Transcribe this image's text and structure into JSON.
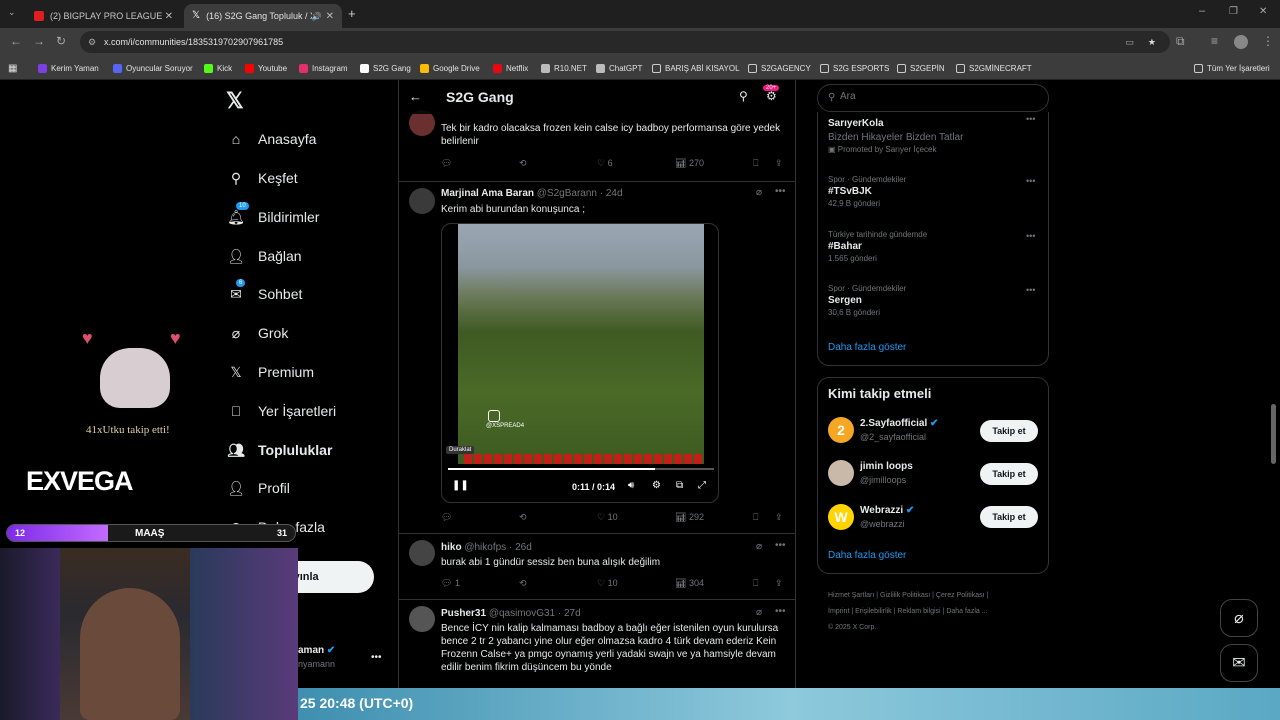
{
  "tabs": [
    {
      "title": "(2) BIGPLAY PRO LEAGUE S9 FI",
      "fav_color": "#e01e22"
    },
    {
      "title": "(16) S2G Gang Topluluk / X",
      "fav_color": "#ffffff"
    }
  ],
  "address": {
    "url": "x.com/i/communities/1835319702907961785"
  },
  "bookmarks": [
    {
      "label": "Kerim Yaman",
      "color": "#7b3fe4"
    },
    {
      "label": "Oyuncular Soruyor",
      "color": "#5865f2"
    },
    {
      "label": "Kick",
      "color": "#53fc18"
    },
    {
      "label": "Youtube",
      "color": "#ff0000"
    },
    {
      "label": "Instagram",
      "color": "#e1306c"
    },
    {
      "label": "S2G Gang",
      "color": "#ffffff"
    },
    {
      "label": "Google Drive",
      "color": "#fbbc04"
    },
    {
      "label": "Netflix",
      "color": "#e50914"
    },
    {
      "label": "R10.NET",
      "color": "#bbbbbb"
    },
    {
      "label": "ChatGPT",
      "color": "#bbbbbb"
    },
    {
      "label": "BARIŞ ABİ KISAYOL",
      "color": "#bbbbbb"
    },
    {
      "label": "S2GAGENCY",
      "color": "#bbbbbb"
    },
    {
      "label": "S2G ESPORTS",
      "color": "#bbbbbb"
    },
    {
      "label": "S2GEPİN",
      "color": "#bbbbbb"
    },
    {
      "label": "S2GMİNECRAFT",
      "color": "#bbbbbb"
    }
  ],
  "all_bookmarks": "Tüm Yer İşaretleri",
  "nav": {
    "items": [
      "Anasayfa",
      "Keşfet",
      "Bildirimler",
      "Bağlan",
      "Sohbet",
      "Grok",
      "Premium",
      "Yer İşaretleri",
      "Topluluklar",
      "Profil",
      "Daha fazla"
    ],
    "notif_badge": "10",
    "chat_badge": "6",
    "post_button": "yayınla",
    "account_name": "aman",
    "account_handle": "nyamann"
  },
  "community": {
    "title": "S2G Gang",
    "notif_count": "20+"
  },
  "tweets": [
    {
      "text": "Tek bir kadro olacaksa frozen kein calse icy badboy performansa göre yedek belirlenir",
      "replies": "",
      "retweets": "",
      "likes": "6",
      "views": "270"
    },
    {
      "name": "Marjinal Ama Baran",
      "handle": "@S2gBarann",
      "time": "· 24d",
      "text": "Kerim abi burundan konuşunca ;",
      "video_time": "0:11 / 0:14",
      "video_tooltip": "Duraklat",
      "video_watermark": "@XSPREAD4",
      "replies": "",
      "retweets": "",
      "likes": "10",
      "views": "292"
    },
    {
      "name": "hiko",
      "handle": "@hikofps",
      "time": "· 26d",
      "text": "burak abi 1 gündür sessiz ben buna alışık değilim",
      "replies": "1",
      "retweets": "",
      "likes": "10",
      "views": "304"
    },
    {
      "name": "Pusher31",
      "handle": "@qasimovG31",
      "time": "· 27d",
      "text": "Bence İCY nin kalip kalmaması badboy a bağlı eğer istenilen oyun kurulursa bence 2 tr 2 yabancı yine olur eğer olmazsa kadro  4 türk devam ederiz Kein Frozenn Calse+ ya pmgc oynamış yerli yadaki swajn ve ya hamsiyle devam edilir benim fikrim düşüncem bu yönde",
      "replies": "",
      "retweets": "",
      "likes": "",
      "views": ""
    }
  ],
  "search": {
    "placeholder": "Ara"
  },
  "trends": [
    {
      "category": "",
      "title": "SarıyerKola",
      "sub": "Bizden Hikayeler Bizden Tatlar",
      "count": "Promoted by Sarıyer İçecek"
    },
    {
      "category": "Spor · Gündemdekiler",
      "title": "#TSvBJK",
      "count": "42,9 B gönderi"
    },
    {
      "category": "Türkiye tarihinde gündemde",
      "title": "#Bahar",
      "count": "1.565 gönderi"
    },
    {
      "category": "Spor · Gündemdekiler",
      "title": "Sergen",
      "count": "30,6 B gönderi"
    }
  ],
  "show_more": "Daha fazla göster",
  "who_to_follow": {
    "title": "Kimi takip etmeli",
    "users": [
      {
        "name": "2.Sayfaofficial",
        "handle": "@2_sayfaofficial",
        "button": "Takip et"
      },
      {
        "name": "jimin loops",
        "handle": "@jimilloops",
        "button": "Takip et"
      },
      {
        "name": "Webrazzi",
        "handle": "@webrazzi",
        "button": "Takip et"
      }
    ],
    "show_more": "Daha fazla göster"
  },
  "footer": {
    "links": [
      "Hizmet Şartları",
      "Gizlilik Politikası",
      "Çerez Politikası",
      "İmprint",
      "Erişilebilirlik",
      "Reklam bilgisi",
      "Daha fazla ..."
    ],
    "copyright": "© 2025 X Corp."
  },
  "overlay": {
    "follow_alert": "41xUtku takip etti!",
    "brand": "EXVEGA",
    "bar_left": "12",
    "bar_label": "MAAŞ",
    "bar_right": "31",
    "bar_fill": 0.35,
    "ticker": "25 20:48 (UTC+0)"
  }
}
